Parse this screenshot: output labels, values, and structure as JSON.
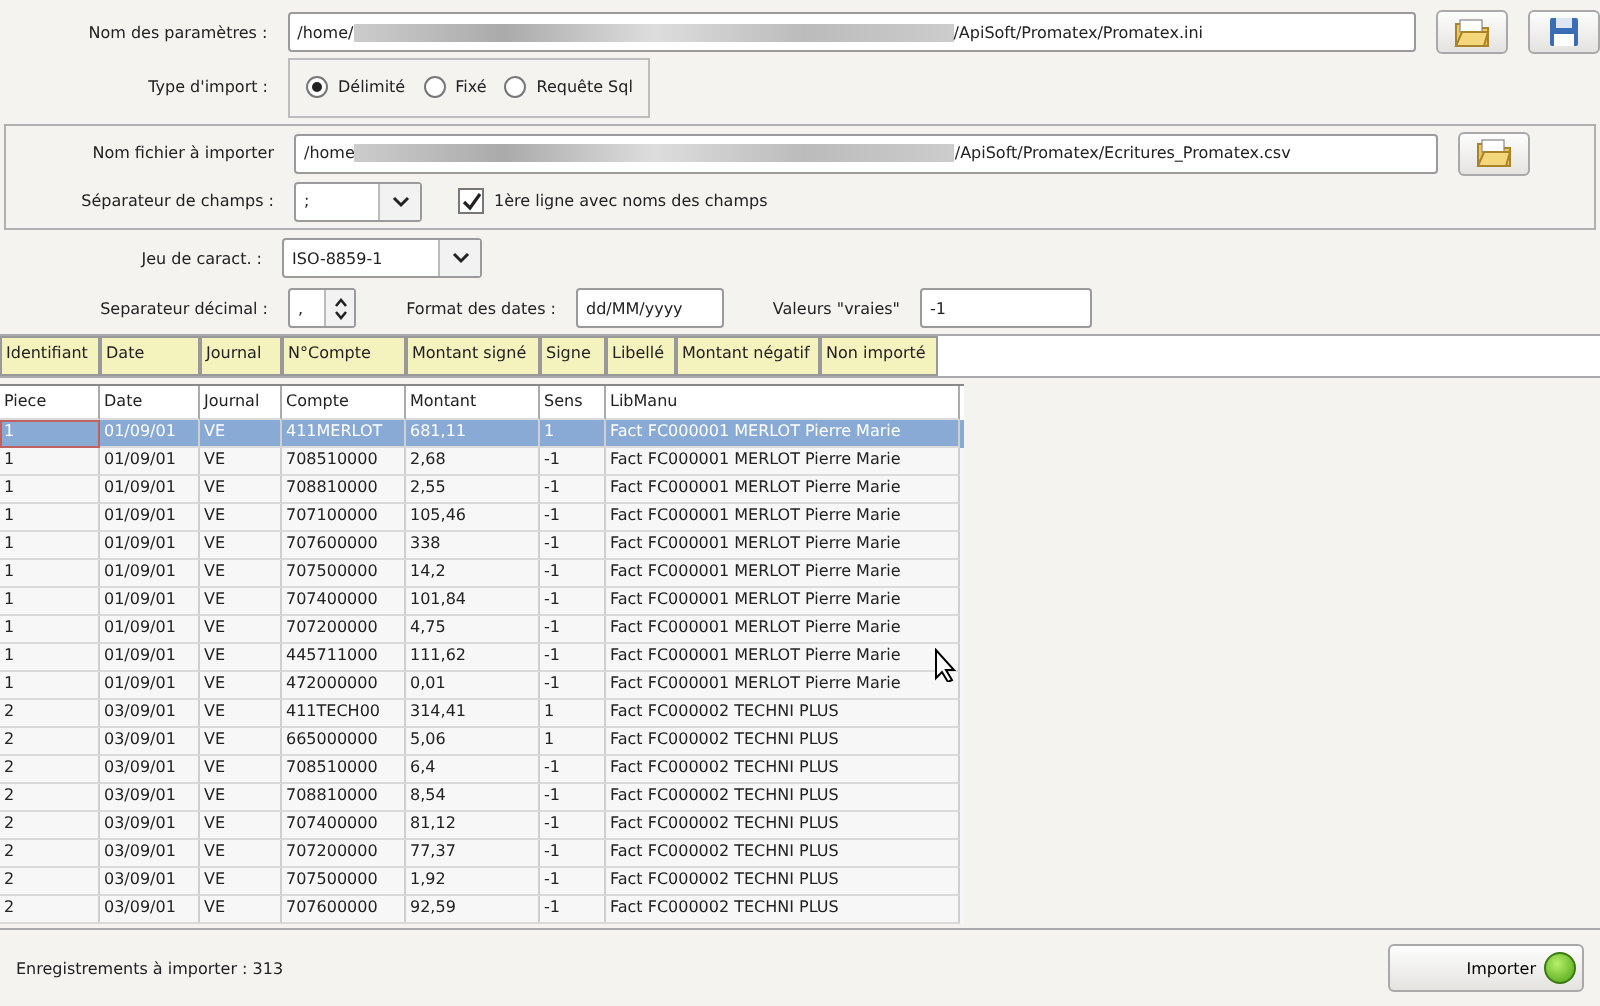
{
  "params": {
    "label": "Nom des paramètres :",
    "path_start": "/home/",
    "path_end": "/ApiSoft/Promatex/Promatex.ini"
  },
  "import_type": {
    "label": "Type d'import :",
    "options": [
      {
        "label": "Délimité",
        "selected": true
      },
      {
        "label": "Fixé",
        "selected": false
      },
      {
        "label": "Requête Sql",
        "selected": false
      }
    ]
  },
  "file": {
    "label": "Nom fichier à importer",
    "path_start": "/home",
    "path_end": "/ApiSoft/Promatex/Ecritures_Promatex.csv"
  },
  "separator": {
    "label": "Séparateur de champs :",
    "value": ";"
  },
  "header_line": {
    "label": "1ère ligne avec noms des champs",
    "checked": true
  },
  "charset": {
    "label": "Jeu de caract. :",
    "value": "ISO-8859-1"
  },
  "decimal": {
    "label": "Separateur décimal :",
    "value": ","
  },
  "date_format": {
    "label": "Format des dates :",
    "value": "dd/MM/yyyy"
  },
  "true_values": {
    "label": "Valeurs \"vraies\"",
    "value": "-1"
  },
  "mapping": [
    "Identifiant",
    "Date",
    "Journal",
    "N°Compte",
    "Montant signé",
    "Signe",
    "Libellé",
    "Montant négatif",
    "Non importé"
  ],
  "table": {
    "columns": [
      "Piece",
      "Date",
      "Journal",
      "Compte",
      "Montant",
      "Sens",
      "LibManu"
    ],
    "rows": [
      {
        "selected": true,
        "cells": [
          "1",
          "01/09/01",
          "VE",
          "411MERLOT",
          "681,11",
          "1",
          "Fact FC000001 MERLOT Pierre Marie"
        ]
      },
      {
        "selected": false,
        "cells": [
          "1",
          "01/09/01",
          "VE",
          "708510000",
          "2,68",
          "-1",
          "Fact FC000001 MERLOT Pierre Marie"
        ]
      },
      {
        "selected": false,
        "cells": [
          "1",
          "01/09/01",
          "VE",
          "708810000",
          "2,55",
          "-1",
          "Fact FC000001 MERLOT Pierre Marie"
        ]
      },
      {
        "selected": false,
        "cells": [
          "1",
          "01/09/01",
          "VE",
          "707100000",
          "105,46",
          "-1",
          "Fact FC000001 MERLOT Pierre Marie"
        ]
      },
      {
        "selected": false,
        "cells": [
          "1",
          "01/09/01",
          "VE",
          "707600000",
          "338",
          "-1",
          "Fact FC000001 MERLOT Pierre Marie"
        ]
      },
      {
        "selected": false,
        "cells": [
          "1",
          "01/09/01",
          "VE",
          "707500000",
          "14,2",
          "-1",
          "Fact FC000001 MERLOT Pierre Marie"
        ]
      },
      {
        "selected": false,
        "cells": [
          "1",
          "01/09/01",
          "VE",
          "707400000",
          "101,84",
          "-1",
          "Fact FC000001 MERLOT Pierre Marie"
        ]
      },
      {
        "selected": false,
        "cells": [
          "1",
          "01/09/01",
          "VE",
          "707200000",
          "4,75",
          "-1",
          "Fact FC000001 MERLOT Pierre Marie"
        ]
      },
      {
        "selected": false,
        "cells": [
          "1",
          "01/09/01",
          "VE",
          "445711000",
          "111,62",
          "-1",
          "Fact FC000001 MERLOT Pierre Marie"
        ]
      },
      {
        "selected": false,
        "cells": [
          "1",
          "01/09/01",
          "VE",
          "472000000",
          "0,01",
          "-1",
          "Fact FC000001 MERLOT Pierre Marie"
        ]
      },
      {
        "selected": false,
        "cells": [
          "2",
          "03/09/01",
          "VE",
          "411TECH00",
          "314,41",
          "1",
          "Fact FC000002 TECHNI PLUS"
        ]
      },
      {
        "selected": false,
        "cells": [
          "2",
          "03/09/01",
          "VE",
          "665000000",
          "5,06",
          "1",
          "Fact FC000002 TECHNI PLUS"
        ]
      },
      {
        "selected": false,
        "cells": [
          "2",
          "03/09/01",
          "VE",
          "708510000",
          "6,4",
          "-1",
          "Fact FC000002 TECHNI PLUS"
        ]
      },
      {
        "selected": false,
        "cells": [
          "2",
          "03/09/01",
          "VE",
          "708810000",
          "8,54",
          "-1",
          "Fact FC000002 TECHNI PLUS"
        ]
      },
      {
        "selected": false,
        "cells": [
          "2",
          "03/09/01",
          "VE",
          "707400000",
          "81,12",
          "-1",
          "Fact FC000002 TECHNI PLUS"
        ]
      },
      {
        "selected": false,
        "cells": [
          "2",
          "03/09/01",
          "VE",
          "707200000",
          "77,37",
          "-1",
          "Fact FC000002 TECHNI PLUS"
        ]
      },
      {
        "selected": false,
        "cells": [
          "2",
          "03/09/01",
          "VE",
          "707500000",
          "1,92",
          "-1",
          "Fact FC000002 TECHNI PLUS"
        ]
      },
      {
        "selected": false,
        "cells": [
          "2",
          "03/09/01",
          "VE",
          "707600000",
          "92,59",
          "-1",
          "Fact FC000002 TECHNI PLUS"
        ]
      }
    ]
  },
  "status": "Enregistrements à importer : 313",
  "import_button": {
    "label": "Importer",
    "ready": true
  }
}
